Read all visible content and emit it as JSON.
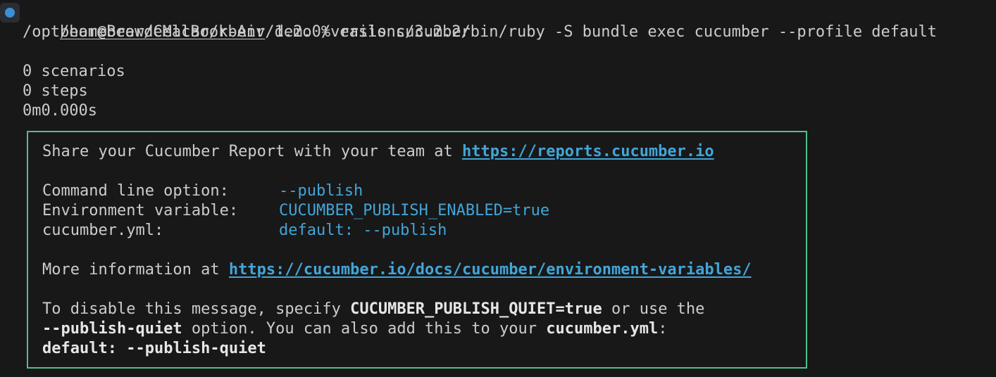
{
  "terminal": {
    "prompt": {
      "user_host": "bear@BeardeMacBook-Air",
      "cwd": "demo",
      "symbol": "%",
      "command": "rails cucumber"
    },
    "exec_line": "/opt/homebrew/Cellar/rbenv/1.2.0/versions/3.2.2/bin/ruby -S bundle exec cucumber --profile default",
    "summary": {
      "scenarios": "0 scenarios",
      "steps": "0 steps",
      "duration": "0m0.000s"
    }
  },
  "banner": {
    "share_text": "Share your Cucumber Report with your team at ",
    "share_link": "https://reports.cucumber.io",
    "options": [
      {
        "label": "Command line option:",
        "value": "--publish",
        "value_suffix": ""
      },
      {
        "label": "Environment variable:",
        "value": "CUCUMBER_PUBLISH_ENABLED",
        "value_suffix": "=true"
      },
      {
        "label": "cucumber.yml:",
        "value": "default: --publish",
        "value_suffix": ""
      }
    ],
    "more_info_text": "More information at ",
    "more_info_link": "https://cucumber.io/docs/cucumber/environment-variables/",
    "disable": {
      "part1": "To disable this message, specify ",
      "env_var": "CUCUMBER_PUBLISH_QUIET=true",
      "part2": " or use the",
      "option": "--publish-quiet",
      "part3": " option. You can also add this to your ",
      "file": "cucumber.yml",
      "part4": ":",
      "yml_key": "default:",
      "yml_value": " --publish-quiet"
    }
  },
  "colors": {
    "background": "#181818",
    "text": "#cccccc",
    "accent_cyan": "#42a5d8",
    "border_green": "#4fc08d",
    "decoration_blue": "#3c8fd6"
  }
}
